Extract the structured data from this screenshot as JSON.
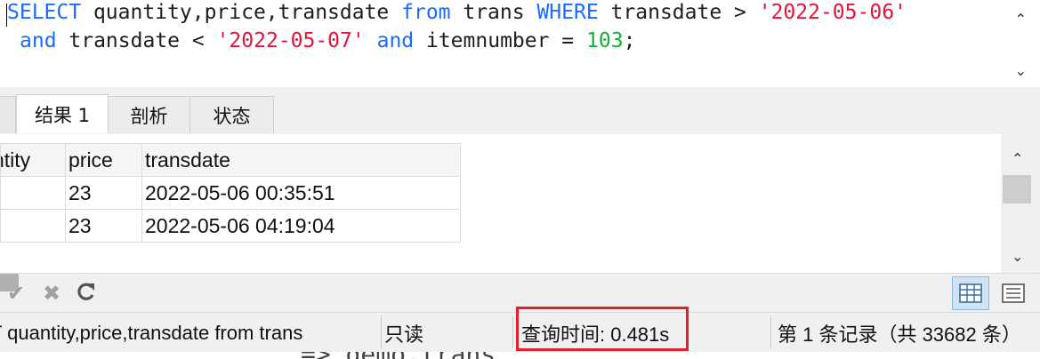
{
  "editor": {
    "line1": {
      "kw_select": "SELECT",
      "t1": " quantity,price,transdate ",
      "kw_from": "from",
      "t2": " trans ",
      "kw_where": "WHERE",
      "t3": " transdate > ",
      "s1": "'2022-05-06'"
    },
    "line2": {
      "kw_and1": "and",
      "t1": " transdate < ",
      "s2": "'2022-05-07'",
      "t2": " ",
      "kw_and2": "and",
      "t3": " itemnumber = ",
      "num": "103",
      "t4": ";"
    }
  },
  "tabs": [
    {
      "label": "结果 1"
    },
    {
      "label": "剖析"
    },
    {
      "label": "状态"
    }
  ],
  "grid": {
    "columns": [
      "ntity",
      "price",
      "transdate"
    ],
    "rows": [
      {
        "quantity": "",
        "price": "23",
        "transdate": "2022-05-06 00:35:51"
      },
      {
        "quantity": "",
        "price": "23",
        "transdate": "2022-05-06 04:19:04"
      }
    ]
  },
  "toolbar": {
    "icons": [
      "check-icon",
      "x-icon",
      "refresh-icon",
      "stop-icon",
      "grid-view-icon",
      "form-view-icon"
    ]
  },
  "statusbar": {
    "sql": "T quantity,price,transdate from trans",
    "readonly": "只读",
    "query_time": "查询时间: 0.481s",
    "records": "第 1 条记录（共 33682 条）"
  },
  "below": {
    "text": "=> demo.trans"
  },
  "colors": {
    "keyword": "#1a6bff",
    "string": "#e0153b",
    "number": "#14b03c",
    "highlight": "#e2202a"
  }
}
